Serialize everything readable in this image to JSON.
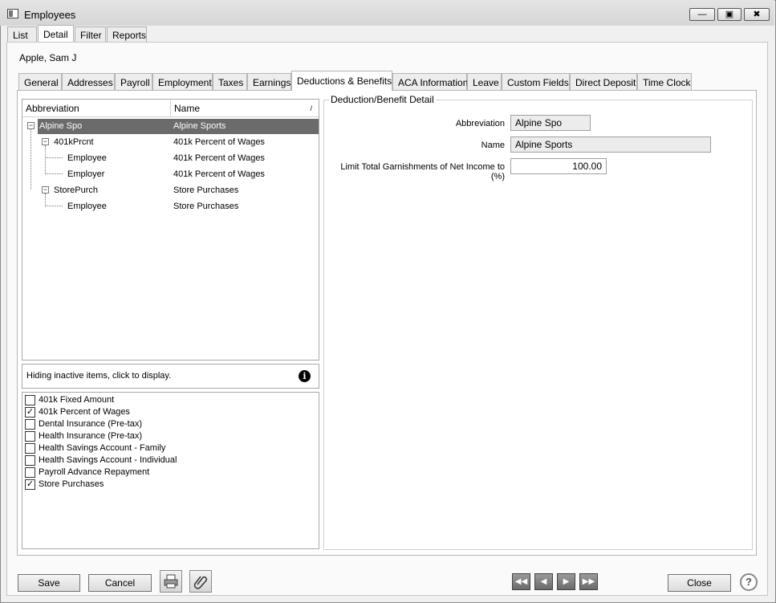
{
  "window": {
    "title": "Employees",
    "min_icon": "minimize-icon",
    "max_icon": "restore-icon",
    "close_icon": "close-icon"
  },
  "main_tabs": [
    {
      "label": "List"
    },
    {
      "label": "Detail",
      "active": true
    },
    {
      "label": "Filter"
    },
    {
      "label": "Reports"
    }
  ],
  "employee_name": "Apple, Sam J",
  "sub_tabs": [
    {
      "label": "General"
    },
    {
      "label": "Addresses"
    },
    {
      "label": "Payroll"
    },
    {
      "label": "Employment"
    },
    {
      "label": "Taxes"
    },
    {
      "label": "Earnings"
    },
    {
      "label": "Deductions & Benefits",
      "active": true
    },
    {
      "label": "ACA Information"
    },
    {
      "label": "Leave"
    },
    {
      "label": "Custom Fields"
    },
    {
      "label": "Direct Deposit"
    },
    {
      "label": "Time Clock"
    }
  ],
  "tree": {
    "col_abbreviation": "Abbreviation",
    "col_name": "Name",
    "sort_glyph": "/",
    "rows": [
      {
        "abbr": "Alpine Spo",
        "name": "Alpine Sports",
        "selected": true
      },
      {
        "abbr": "401kPrcnt",
        "name": "401k Percent of Wages"
      },
      {
        "abbr": "Employee",
        "name": "401k Percent of Wages"
      },
      {
        "abbr": "Employer",
        "name": "401k Percent of Wages"
      },
      {
        "abbr": "StorePurch",
        "name": "Store Purchases"
      },
      {
        "abbr": "Employee",
        "name": "Store Purchases"
      }
    ]
  },
  "info_bar": {
    "text": "Hiding inactive items, click to display.",
    "icon": "info-icon"
  },
  "checklist": [
    {
      "label": "401k Fixed Amount",
      "checked": false
    },
    {
      "label": "401k Percent of Wages",
      "checked": true
    },
    {
      "label": "Dental Insurance (Pre-tax)",
      "checked": false
    },
    {
      "label": "Health Insurance (Pre-tax)",
      "checked": false
    },
    {
      "label": "Health Savings Account - Family",
      "checked": false
    },
    {
      "label": "Health Savings Account - Individual",
      "checked": false
    },
    {
      "label": "Payroll Advance Repayment",
      "checked": false
    },
    {
      "label": "Store Purchases",
      "checked": true
    }
  ],
  "detail": {
    "legend": "Deduction/Benefit Detail",
    "abbreviation_label": "Abbreviation",
    "abbreviation_value": "Alpine Spo",
    "name_label": "Name",
    "name_value": "Alpine Sports",
    "limit_label": "Limit Total Garnishments of Net Income to (%)",
    "limit_value": "100.00"
  },
  "footer": {
    "save_label": "Save",
    "cancel_label": "Cancel",
    "close_label": "Close",
    "print_icon": "printer-icon",
    "attach_icon": "paperclip-icon",
    "help_label": "?"
  }
}
